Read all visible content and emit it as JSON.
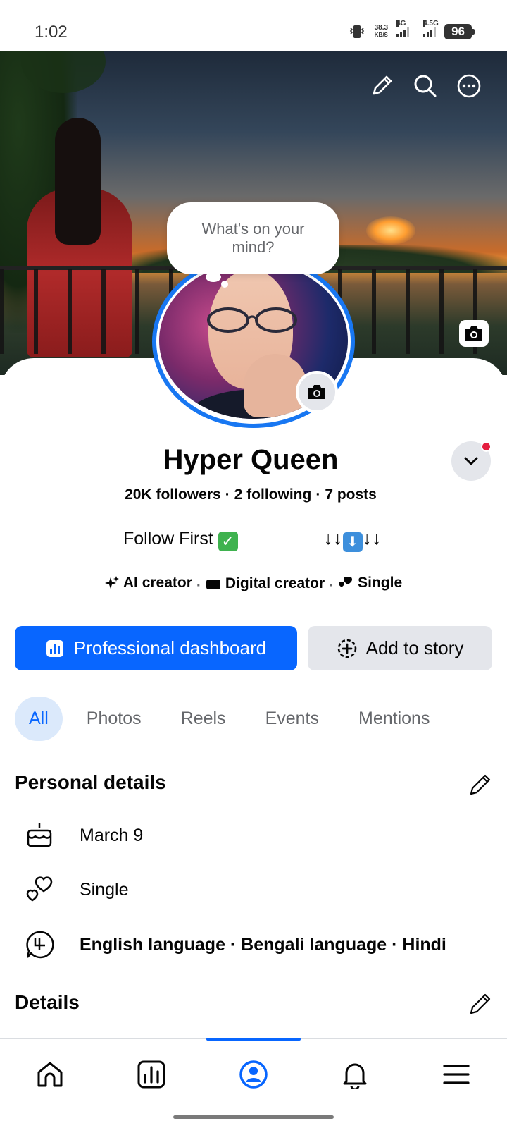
{
  "status_bar": {
    "time": "1:02",
    "net_speed_value": "38.3",
    "net_speed_unit": "KB/S",
    "signal1": "4G",
    "signal2": "4.5G",
    "battery": "96"
  },
  "cover": {
    "bubble_text": "What's on your mind?"
  },
  "profile": {
    "name": "Hyper Queen",
    "followers": "20K followers",
    "following": "2 following",
    "posts": "7 posts",
    "bio_left": "Follow First",
    "bio_check": "✓",
    "bio_right_prefix": "↓↓",
    "bio_right_box": "⬇",
    "bio_right_suffix": "↓↓",
    "categories": [
      "AI creator",
      "Digital creator",
      "Single"
    ]
  },
  "actions": {
    "primary_label": "Professional dashboard",
    "secondary_label": "Add to story"
  },
  "tabs": [
    "All",
    "Photos",
    "Reels",
    "Events",
    "Mentions"
  ],
  "active_tab": "All",
  "personal_details": {
    "title": "Personal details",
    "birthday": "March 9",
    "relationship": "Single",
    "languages": "English language · Bengali language · Hindi"
  },
  "details": {
    "title": "Details"
  },
  "colors": {
    "brand_blue": "#0866ff",
    "ring_blue": "#1877f2",
    "notification_red": "#e41e3f",
    "button_gray": "#e4e6eb"
  },
  "icons": {
    "nav": [
      "home-icon",
      "dashboard-icon",
      "profile-icon",
      "bell-icon",
      "menu-icon"
    ]
  }
}
